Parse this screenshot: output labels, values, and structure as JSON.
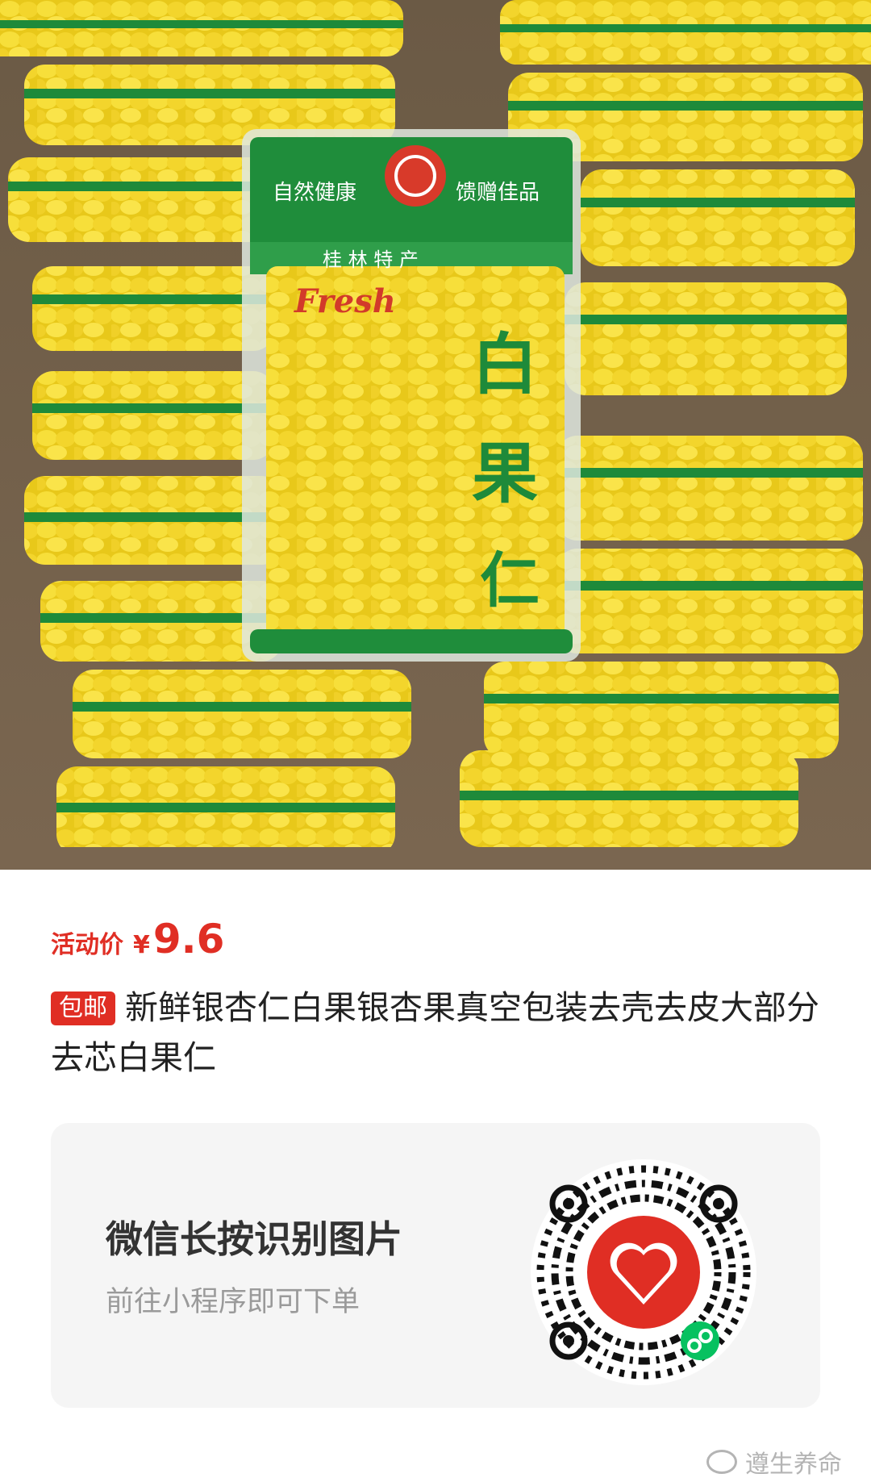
{
  "product_image": {
    "alt_icon": "ginkgo-nut-packages-photo",
    "package_texts": [
      "自然健康",
      "馈赠佳品",
      "桂 林 特 产",
      "Fresh",
      "白",
      "果",
      "仁"
    ]
  },
  "price": {
    "label": "活动价",
    "currency": "¥",
    "value": "9.6"
  },
  "title": {
    "badge": "包邮",
    "text": "新鲜银杏仁白果银杏果真空包装去壳去皮大部分去芯白果仁"
  },
  "mini_program_card": {
    "title": "微信长按识别图片",
    "subtitle": "前往小程序即可下单",
    "qr_icon": "mini-program-qr-code-icon"
  },
  "watermark": {
    "text": "遵生养命",
    "icon": "wechat-icon"
  },
  "colors": {
    "accent": "#e02e24",
    "card_bg": "#f5f5f5",
    "package_green": "#1e8a3a",
    "nut_yellow": "#f2d21e"
  }
}
